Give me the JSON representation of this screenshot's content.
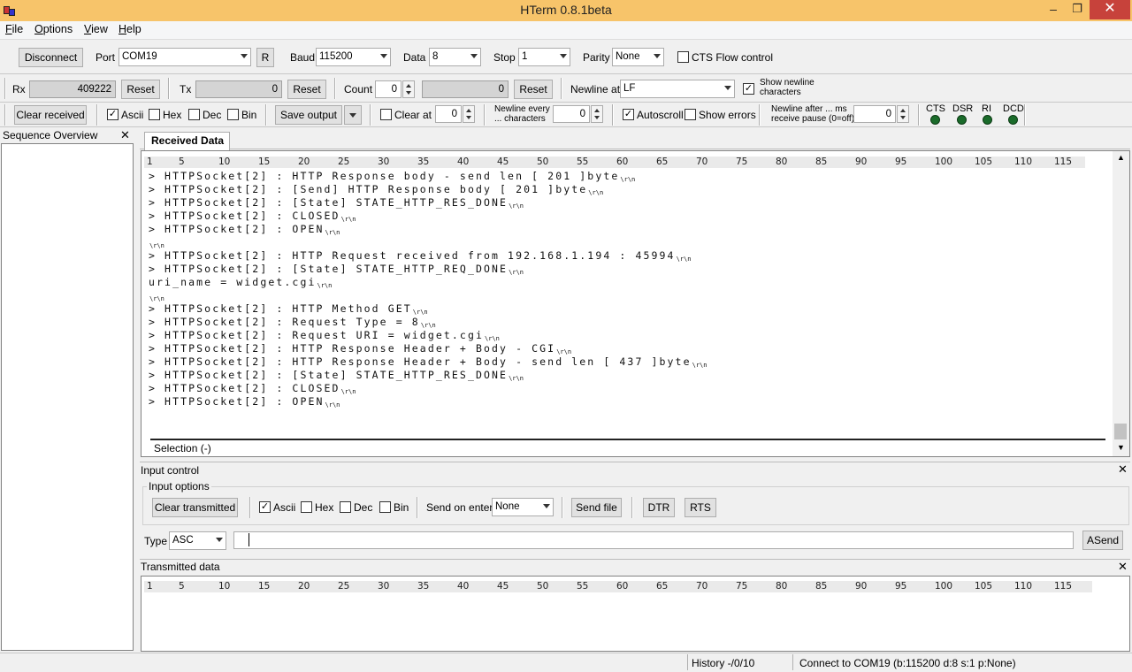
{
  "window": {
    "title": "HTerm 0.8.1beta",
    "minimize": "‒",
    "restore": "❐",
    "close": "✕"
  },
  "menu": {
    "file": "File",
    "options": "Options",
    "view": "View",
    "help": "Help"
  },
  "connection": {
    "disconnect_label": "Disconnect",
    "port_label": "Port",
    "port_value": "COM19",
    "r_label": "R",
    "baud_label": "Baud",
    "baud_value": "115200",
    "data_label": "Data",
    "data_value": "8",
    "stop_label": "Stop",
    "stop_value": "1",
    "parity_label": "Parity",
    "parity_value": "None",
    "cts_flow_label": "CTS Flow control",
    "cts_flow_checked": false
  },
  "counters": {
    "rx_label": "Rx",
    "rx_value": "409222",
    "rx_reset": "Reset",
    "tx_label": "Tx",
    "tx_value": "0",
    "tx_reset": "Reset",
    "count_label": "Count",
    "count_value": "0",
    "count_total": "0",
    "count_reset": "Reset",
    "newline_at_label": "Newline at",
    "newline_at_value": "LF",
    "show_newline_label_1": "Show newline",
    "show_newline_label_2": "characters",
    "show_newline_checked": true
  },
  "display": {
    "clear_received": "Clear received",
    "ascii": "Ascii",
    "ascii_checked": true,
    "hex": "Hex",
    "hex_checked": false,
    "dec": "Dec",
    "dec_checked": false,
    "bin": "Bin",
    "bin_checked": false,
    "save_output": "Save output",
    "clear_at_label": "Clear at",
    "clear_at_value": "0",
    "clear_at_checked": false,
    "newline_every_1": "Newline every",
    "newline_every_2": "... characters",
    "newline_every_value": "0",
    "autoscroll": "Autoscroll",
    "autoscroll_checked": true,
    "show_errors": "Show errors",
    "show_errors_checked": false,
    "newline_after_1": "Newline after ... ms",
    "newline_after_2": "receive pause (0=off)",
    "newline_after_value": "0",
    "signals": [
      "CTS",
      "DSR",
      "RI",
      "DCD"
    ]
  },
  "sequence": {
    "title": "Sequence Overview",
    "close": "✕"
  },
  "received": {
    "tab": "Received Data",
    "ruler": [
      "1",
      "5",
      "10",
      "15",
      "20",
      "25",
      "30",
      "35",
      "40",
      "45",
      "50",
      "55",
      "60",
      "65",
      "70",
      "75",
      "80",
      "85",
      "90",
      "95",
      "100",
      "105",
      "110",
      "115"
    ],
    "crlf": "\\r\\n",
    "lines": [
      {
        "text": "> HTTPSocket[2] : HTTP Response body - send len [ 201 ]byte",
        "nl": true
      },
      {
        "text": "> HTTPSocket[2] : [Send] HTTP Response body [ 201 ]byte",
        "nl": true
      },
      {
        "text": "> HTTPSocket[2] : [State] STATE_HTTP_RES_DONE",
        "nl": true
      },
      {
        "text": "> HTTPSocket[2] : CLOSED",
        "nl": true
      },
      {
        "text": "> HTTPSocket[2] : OPEN",
        "nl": true
      },
      {
        "text": "",
        "nl": true
      },
      {
        "text": "> HTTPSocket[2] : HTTP Request received from 192.168.1.194 : 45994",
        "nl": true
      },
      {
        "text": "> HTTPSocket[2] : [State] STATE_HTTP_REQ_DONE",
        "nl": true
      },
      {
        "text": "uri_name = widget.cgi",
        "nl": true
      },
      {
        "text": "",
        "nl": true
      },
      {
        "text": "> HTTPSocket[2] : HTTP Method GET",
        "nl": true
      },
      {
        "text": "> HTTPSocket[2] : Request Type = 8",
        "nl": true
      },
      {
        "text": "> HTTPSocket[2] : Request URI = widget.cgi",
        "nl": true
      },
      {
        "text": "> HTTPSocket[2] : HTTP Response Header + Body - CGI",
        "nl": true
      },
      {
        "text": "> HTTPSocket[2] : HTTP Response Header + Body - send len [ 437 ]byte",
        "nl": true
      },
      {
        "text": "> HTTPSocket[2] : [State] STATE_HTTP_RES_DONE",
        "nl": true
      },
      {
        "text": "> HTTPSocket[2] : CLOSED",
        "nl": true
      },
      {
        "text": "> HTTPSocket[2] : OPEN",
        "nl": true
      }
    ],
    "selection": "Selection (-)"
  },
  "input": {
    "title": "Input control",
    "close": "✕",
    "options_title": "Input options",
    "clear_transmitted": "Clear transmitted",
    "ascii": "Ascii",
    "ascii_checked": true,
    "hex": "Hex",
    "dec": "Dec",
    "bin": "Bin",
    "send_on_enter_label": "Send on enter",
    "send_on_enter_value": "None",
    "send_file": "Send file",
    "dtr": "DTR",
    "rts": "RTS",
    "type_label": "Type",
    "type_value": "ASC",
    "type_text": "",
    "asend": "ASend"
  },
  "transmitted": {
    "title": "Transmitted data",
    "close": "✕"
  },
  "status": {
    "history": "History -/0/10",
    "connection": "Connect to COM19 (b:115200 d:8 s:1 p:None)"
  }
}
